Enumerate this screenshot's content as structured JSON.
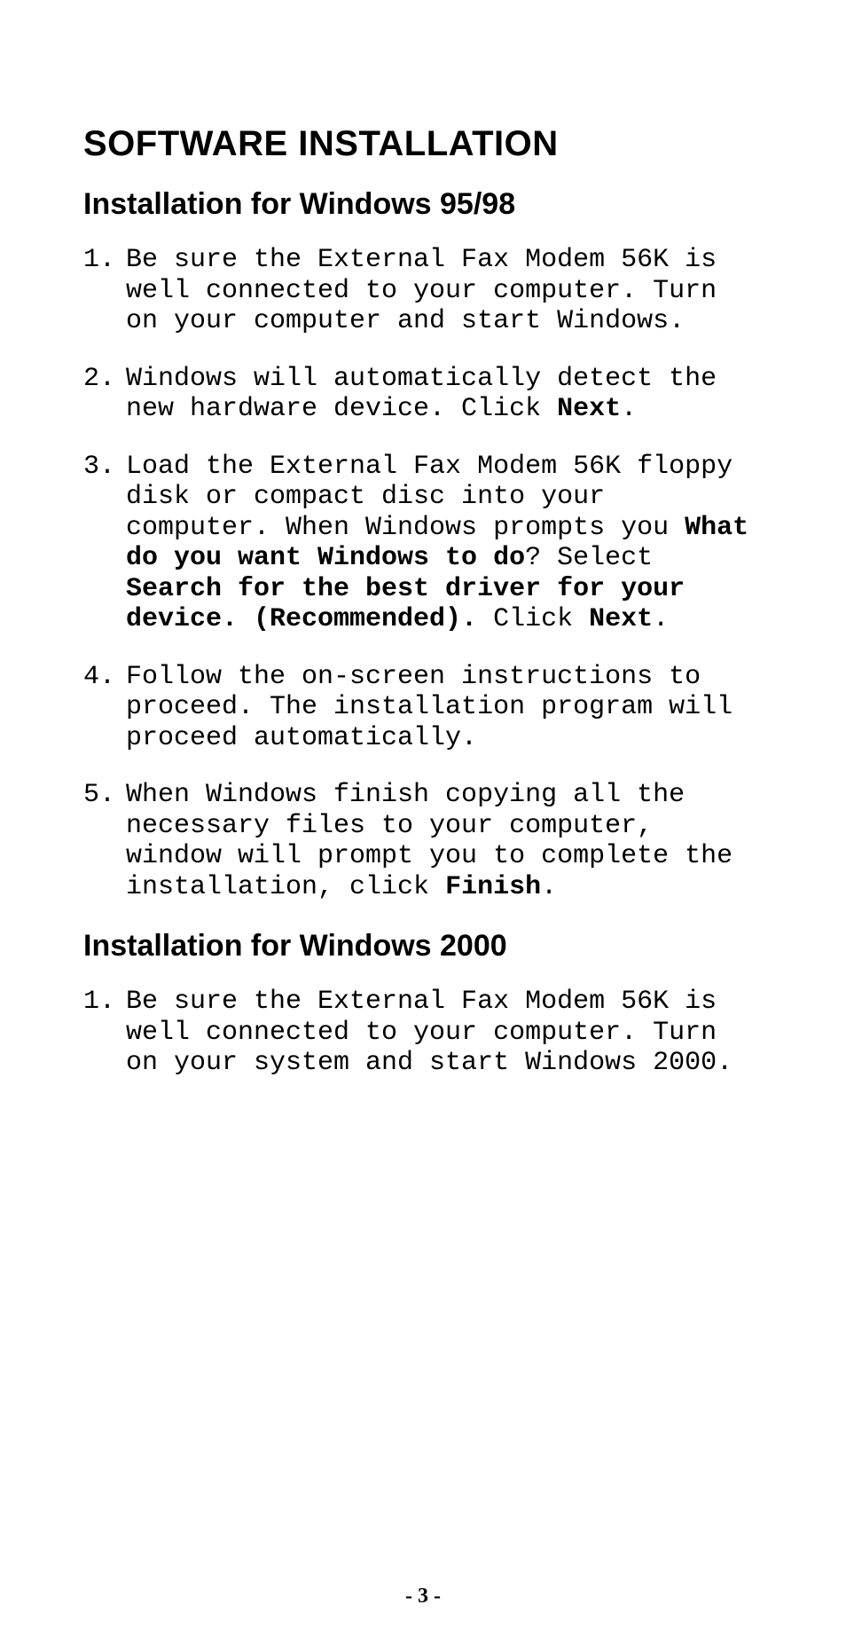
{
  "headings": {
    "main": "SOFTWARE INSTALLATION",
    "section_a": "Installation for Windows 95/98",
    "section_b": "Installation for Windows 2000"
  },
  "lists": {
    "section_a": [
      {
        "parts": [
          {
            "text": "Be sure the External Fax Modem 56K is well connected to your computer. Turn on your computer and start Windows.",
            "bold": false
          }
        ]
      },
      {
        "parts": [
          {
            "text": "Windows will automatically detect the new hardware device. Click ",
            "bold": false
          },
          {
            "text": "Next",
            "bold": true
          },
          {
            "text": ".",
            "bold": false
          }
        ]
      },
      {
        "parts": [
          {
            "text": "Load the External Fax Modem 56K floppy disk or compact disc into your computer. When Windows prompts you ",
            "bold": false
          },
          {
            "text": "What do you want Windows to do",
            "bold": true
          },
          {
            "text": "? Select ",
            "bold": false
          },
          {
            "text": "Search for the best driver for your device. (Recommended).",
            "bold": true
          },
          {
            "text": " Click ",
            "bold": false
          },
          {
            "text": "Next",
            "bold": true
          },
          {
            "text": ".",
            "bold": false
          }
        ]
      },
      {
        "parts": [
          {
            "text": "Follow the on-screen instructions to proceed. The installation program will proceed automatically.",
            "bold": false
          }
        ]
      },
      {
        "parts": [
          {
            "text": "When Windows finish copying all the necessary files to your computer, window will prompt you to complete the installation, click ",
            "bold": false
          },
          {
            "text": "Finish",
            "bold": true
          },
          {
            "text": ".",
            "bold": false
          }
        ]
      }
    ],
    "section_b": [
      {
        "parts": [
          {
            "text": "Be sure the External Fax Modem 56K is well connected to your computer. Turn on your system and start Windows 2000.",
            "bold": false
          }
        ]
      }
    ]
  },
  "page_number": "- 3 -"
}
